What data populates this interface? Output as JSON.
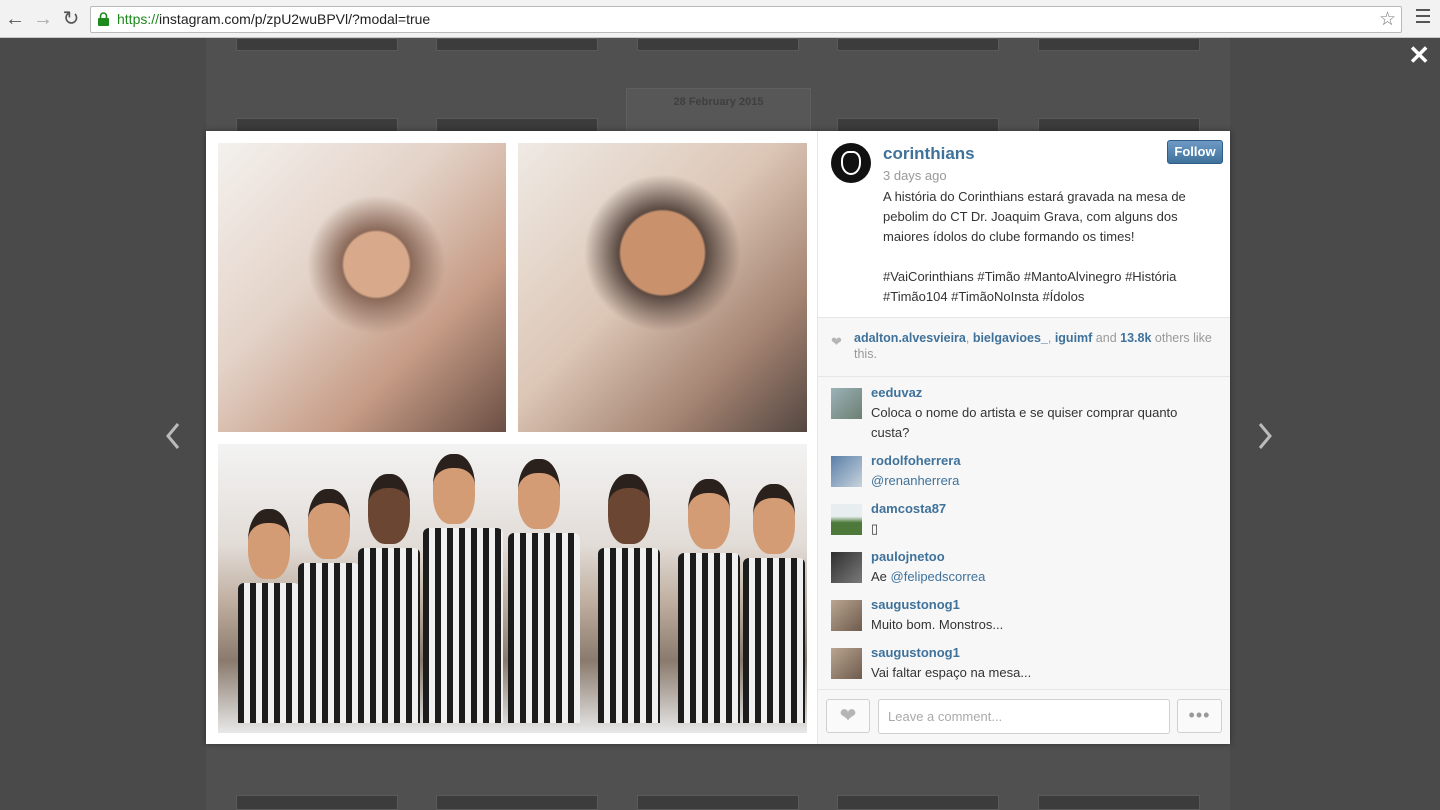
{
  "browser": {
    "url_scheme": "https://",
    "url_rest": "instagram.com/p/zpU2wuBPVl/?modal=true"
  },
  "background_page": {
    "date_label": "28 February 2015"
  },
  "post": {
    "username": "corinthians",
    "time_ago": "3 days ago",
    "follow_label": "Follow",
    "caption": "A história do Corinthians estará gravada na mesa de pebolim do CT Dr. Joaquim Grava, com alguns dos maiores ídolos do clube formando os times!\n\n#VaiCorinthians #Timão #MantoAlvinegro #História #Timão104 #TimãoNoInsta #Ídolos",
    "likes": {
      "user1": "adalton.alvesvieira",
      "sep1": ", ",
      "user2": "bielgavioes_",
      "sep2": ", ",
      "user3": "iguimf",
      "and": " and ",
      "count": "13.8k",
      "rest": " others like this."
    }
  },
  "comments": [
    {
      "user": "eeduvaz",
      "text": "Coloca o nome do artista e se quiser comprar quanto custa?"
    },
    {
      "user": "rodolfoherrera",
      "mention": "@renanherrera"
    },
    {
      "user": "damcosta87",
      "text": "▯"
    },
    {
      "user": "paulojnetoo",
      "text": "Ae ",
      "mention": "@felipedscorrea"
    },
    {
      "user": "saugustonog1",
      "text": "Muito bom. Monstros..."
    },
    {
      "user": "saugustonog1",
      "text": "Vai faltar espaço na mesa..."
    }
  ],
  "comment_box": {
    "placeholder": "Leave a comment...",
    "more_label": "•••"
  },
  "icons": {
    "back": "back-arrow-icon",
    "forward": "forward-arrow-icon",
    "reload": "reload-icon",
    "lock": "lock-icon",
    "star": "star-icon",
    "menu": "hamburger-menu-icon",
    "close": "close-icon",
    "prev": "chevron-left-icon",
    "next": "chevron-right-icon",
    "heart": "heart-icon"
  },
  "colors": {
    "link_blue": "#3f729b",
    "url_green": "#1e8a1e",
    "overlay": "#4a4a4a"
  }
}
